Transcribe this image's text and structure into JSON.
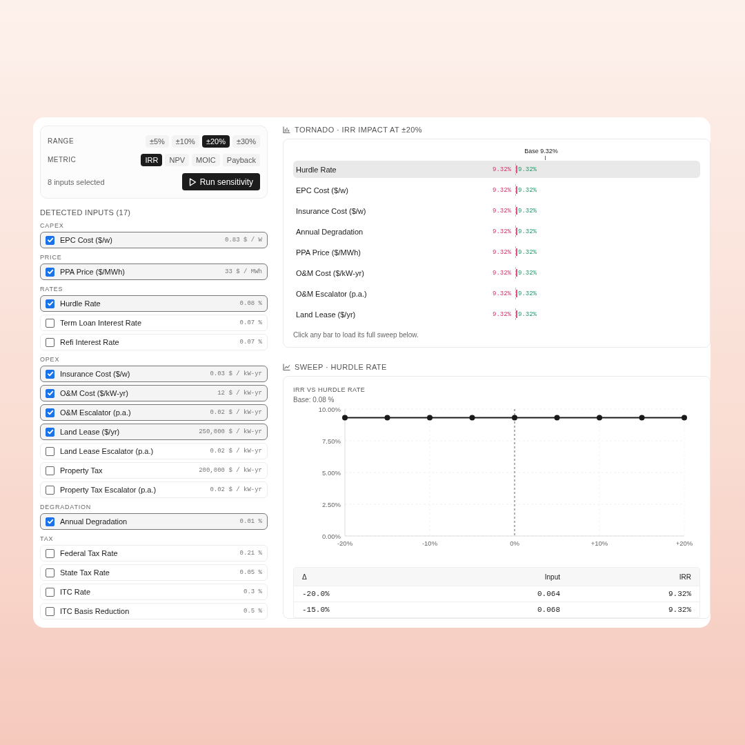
{
  "controls": {
    "range_label": "RANGE",
    "ranges": [
      {
        "label": "±5%",
        "selected": false
      },
      {
        "label": "±10%",
        "selected": false
      },
      {
        "label": "±20%",
        "selected": true
      },
      {
        "label": "±30%",
        "selected": false
      }
    ],
    "metric_label": "METRIC",
    "metrics": [
      {
        "label": "IRR",
        "selected": true
      },
      {
        "label": "NPV",
        "selected": false
      },
      {
        "label": "MOIC",
        "selected": false
      },
      {
        "label": "Payback",
        "selected": false
      }
    ],
    "selected_count": "8 inputs selected",
    "run_button": "Run sensitivity"
  },
  "inputs_title": "DETECTED INPUTS (17)",
  "groups": [
    {
      "name": "CAPEX",
      "items": [
        {
          "label": "EPC Cost ($/w)",
          "value": "0.83 $ / W",
          "checked": true
        }
      ]
    },
    {
      "name": "PRICE",
      "items": [
        {
          "label": "PPA Price ($/MWh)",
          "value": "33 $ / MWh",
          "checked": true
        }
      ]
    },
    {
      "name": "RATES",
      "items": [
        {
          "label": "Hurdle Rate",
          "value": "0.08 %",
          "checked": true
        },
        {
          "label": "Term Loan Interest Rate",
          "value": "0.07 %",
          "checked": false
        },
        {
          "label": "Refi Interest Rate",
          "value": "0.07 %",
          "checked": false
        }
      ]
    },
    {
      "name": "OPEX",
      "items": [
        {
          "label": "Insurance Cost ($/w)",
          "value": "0.03 $ / kW-yr",
          "checked": true
        },
        {
          "label": "O&M Cost ($/kW-yr)",
          "value": "12 $ / kW-yr",
          "checked": true
        },
        {
          "label": "O&M Escalator (p.a.)",
          "value": "0.02 $ / kW-yr",
          "checked": true
        },
        {
          "label": "Land Lease ($/yr)",
          "value": "250,000 $ / kW-yr",
          "checked": true
        },
        {
          "label": "Land Lease Escalator (p.a.)",
          "value": "0.02 $ / kW-yr",
          "checked": false
        },
        {
          "label": "Property Tax",
          "value": "200,000 $ / kW-yr",
          "checked": false
        },
        {
          "label": "Property Tax Escalator (p.a.)",
          "value": "0.02 $ / kW-yr",
          "checked": false
        }
      ]
    },
    {
      "name": "DEGRADATION",
      "items": [
        {
          "label": "Annual Degradation",
          "value": "0.01 %",
          "checked": true
        }
      ]
    },
    {
      "name": "TAX",
      "items": [
        {
          "label": "Federal Tax Rate",
          "value": "0.21 %",
          "checked": false
        },
        {
          "label": "State Tax Rate",
          "value": "0.05 %",
          "checked": false
        },
        {
          "label": "ITC Rate",
          "value": "0.3 %",
          "checked": false
        },
        {
          "label": "ITC Basis Reduction",
          "value": "0.5 %",
          "checked": false
        }
      ]
    }
  ],
  "tornado": {
    "title": "TORNADO · IRR IMPACT AT ±20%",
    "base_label": "Base 9.32%",
    "hint": "Click any bar to load its full sweep below.",
    "rows": [
      {
        "label": "Hurdle Rate",
        "low": "9.32%",
        "high": "9.32%",
        "selected": true
      },
      {
        "label": "EPC Cost ($/w)",
        "low": "9.32%",
        "high": "9.32%",
        "selected": false
      },
      {
        "label": "Insurance Cost ($/w)",
        "low": "9.32%",
        "high": "9.32%",
        "selected": false
      },
      {
        "label": "Annual Degradation",
        "low": "9.32%",
        "high": "9.32%",
        "selected": false
      },
      {
        "label": "PPA Price ($/MWh)",
        "low": "9.32%",
        "high": "9.32%",
        "selected": false
      },
      {
        "label": "O&M Cost ($/kW-yr)",
        "low": "9.32%",
        "high": "9.32%",
        "selected": false
      },
      {
        "label": "O&M Escalator (p.a.)",
        "low": "9.32%",
        "high": "9.32%",
        "selected": false
      },
      {
        "label": "Land Lease ($/yr)",
        "low": "9.32%",
        "high": "9.32%",
        "selected": false
      }
    ]
  },
  "sweep": {
    "title": "SWEEP · HURDLE RATE",
    "chart_title": "IRR VS HURDLE RATE",
    "base": "Base: 0.08 %",
    "chart_data": {
      "type": "line",
      "x": [
        -20,
        -15,
        -10,
        -5,
        0,
        5,
        10,
        15,
        20
      ],
      "series": [
        {
          "color": "#1a1a1a",
          "marker": true,
          "values": [
            9.32,
            9.32,
            9.32,
            9.32,
            9.32,
            9.32,
            9.32,
            9.32,
            9.32
          ]
        }
      ],
      "grid": true,
      "xlim": [
        -20,
        20
      ],
      "ylim": [
        0,
        10
      ],
      "xticks": [
        {
          "value": -20,
          "label": "-20%"
        },
        {
          "value": -10,
          "label": "-10%"
        },
        {
          "value": 0,
          "label": "0%"
        },
        {
          "value": 10,
          "label": "+10%"
        },
        {
          "value": 20,
          "label": "+20%"
        }
      ],
      "yticks": [
        {
          "value": 0,
          "label": "0.00%"
        },
        {
          "value": 2.5,
          "label": "2.50%"
        },
        {
          "value": 5,
          "label": "5.00%"
        },
        {
          "value": 7.5,
          "label": "7.50%"
        },
        {
          "value": 10,
          "label": "10.00%"
        }
      ],
      "ref_lines": [
        {
          "axis": "x",
          "value": 0
        }
      ]
    },
    "table": {
      "columns": [
        "Δ",
        "Input",
        "IRR"
      ],
      "rows": [
        [
          "-20.0%",
          "0.064",
          "9.32%"
        ],
        [
          "-15.0%",
          "0.068",
          "9.32%"
        ]
      ]
    }
  }
}
